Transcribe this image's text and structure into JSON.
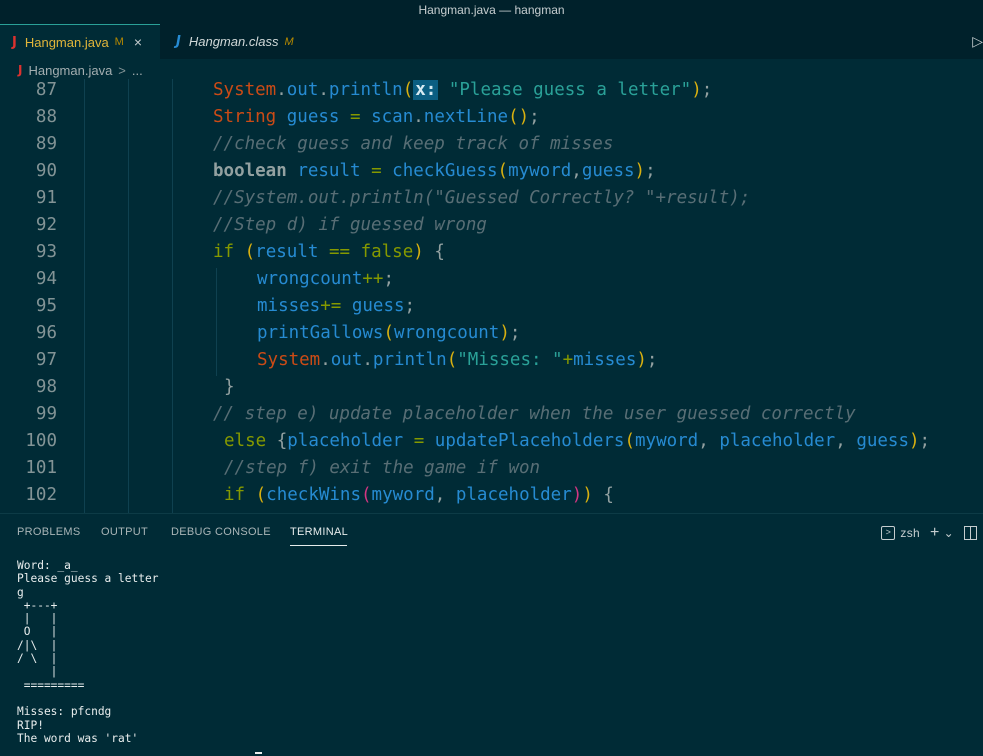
{
  "window": {
    "title": "Hangman.java — hangman"
  },
  "tabs": [
    {
      "icon": "J",
      "label": "Hangman.java",
      "status": "M",
      "close": "×"
    },
    {
      "icon": "J",
      "label": "Hangman.class",
      "status": "M"
    }
  ],
  "breadcrumb": {
    "icon": "J",
    "file": "Hangman.java",
    "separator": ">",
    "more": "..."
  },
  "editor": {
    "line_numbers": [
      "87",
      "88",
      "89",
      "90",
      "91",
      "92",
      "93",
      "94",
      "95",
      "96",
      "97",
      "98",
      "99",
      "100",
      "101",
      "102"
    ],
    "inlay_hint": "x:"
  },
  "panel": {
    "tabs": [
      "PROBLEMS",
      "OUTPUT",
      "DEBUG CONSOLE",
      "TERMINAL"
    ],
    "active_tab": "TERMINAL",
    "shell_name": "zsh",
    "add_symbol": "+",
    "dropdown_symbol": "⌄",
    "icons": [
      "terminal-icon",
      "add-icon",
      "chevron-down-icon",
      "split-icon"
    ]
  },
  "terminal": {
    "lines": [
      "Word: _a_",
      "Please guess a letter",
      "g",
      " +---+",
      " |   |",
      " O   |",
      "/|\\  |",
      "/ \\  |",
      "     |",
      " =========",
      "",
      "Misses: pfcndg",
      "RIP!",
      "The word was 'rat'"
    ]
  },
  "colors": {
    "background": "#002b36",
    "keyword": "#859900",
    "type": "#cb4b16",
    "identifier": "#268bd2",
    "string": "#2aa198",
    "comment": "#586e75"
  }
}
